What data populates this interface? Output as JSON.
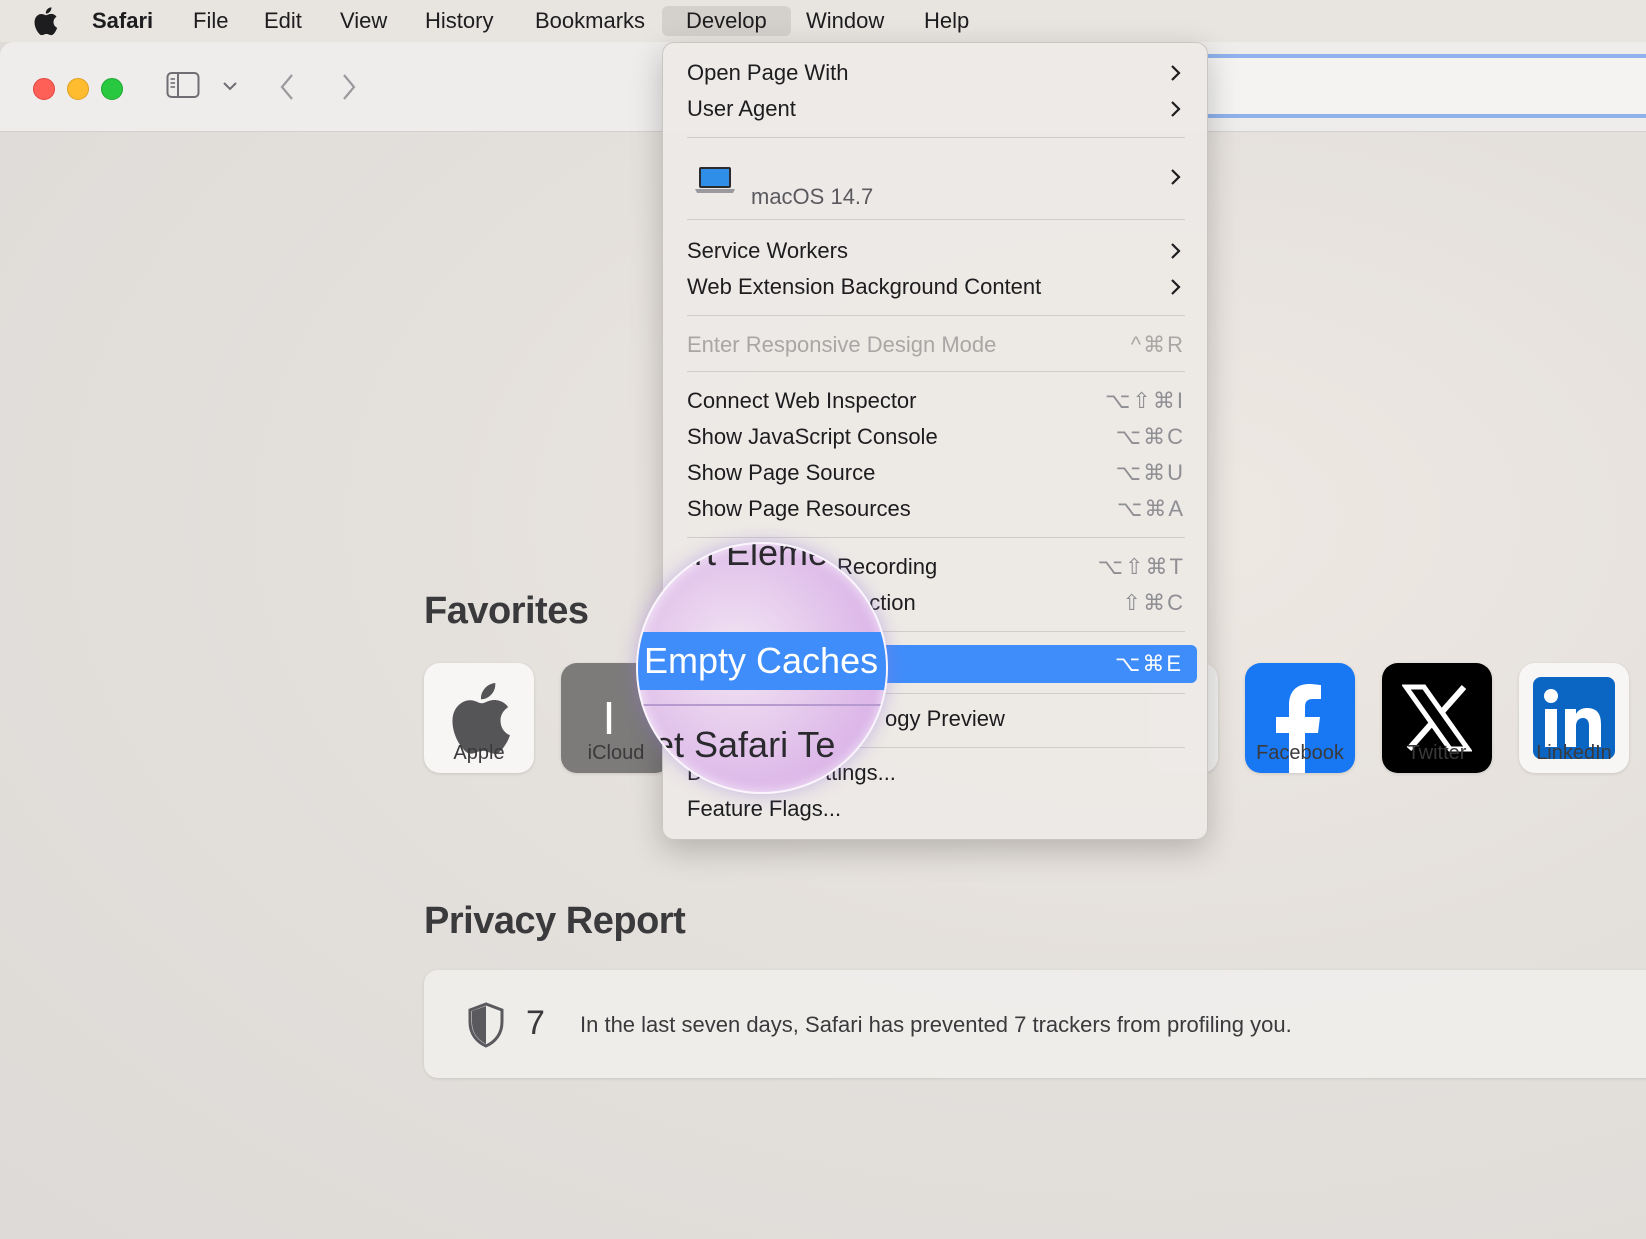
{
  "menubar": {
    "apple_icon": "apple-logo-icon",
    "app": "Safari",
    "items": [
      "File",
      "Edit",
      "View",
      "History",
      "Bookmarks",
      "Develop",
      "Window",
      "Help"
    ],
    "active": "Develop"
  },
  "toolbar": {
    "icons": [
      "sidebar-icon",
      "chevron-down-icon",
      "back-icon",
      "forward-icon"
    ]
  },
  "develop_menu": {
    "open_page_with": "Open Page With",
    "user_agent": "User Agent",
    "device": "macOS 14.7",
    "service_workers": "Service Workers",
    "web_extension": "Web Extension Background Content",
    "responsive": {
      "label": "Enter Responsive Design Mode",
      "shortcut": "^⌘R"
    },
    "connect_inspector": {
      "label": "Connect Web Inspector",
      "shortcut": "⌥⇧⌘I"
    },
    "js_console": {
      "label": "Show JavaScript Console",
      "shortcut": "⌥⌘C"
    },
    "page_source": {
      "label": "Show Page Source",
      "shortcut": "⌥⌘U"
    },
    "page_resources": {
      "label": "Show Page Resources",
      "shortcut": "⌥⌘A"
    },
    "recording": {
      "label": "Recording",
      "shortcut": "⌥⇧⌘T"
    },
    "selection": {
      "label": "ection",
      "shortcut": "⇧⌘C"
    },
    "empty_caches": {
      "shortcut": "⌥⌘E"
    },
    "tech_preview": "ogy Preview",
    "settings": "ttings...",
    "settings_prefix": "D",
    "feature_flags": "Feature Flags..."
  },
  "magnifier": {
    "top_text": "art Eleme",
    "highlight_text": "Empty Caches",
    "bottom_text": "et Safari Te"
  },
  "favorites": {
    "title": "Favorites",
    "items": [
      {
        "label": "Apple",
        "icon": "apple-logo-icon"
      },
      {
        "label": "iCloud",
        "icon": "icloud-icon"
      },
      {
        "label": "Facebook",
        "icon": "facebook-icon"
      },
      {
        "label": "Twitter",
        "icon": "x-icon"
      },
      {
        "label": "LinkedIn",
        "icon": "linkedin-icon"
      }
    ],
    "icloud_glyph": "I"
  },
  "privacy": {
    "title": "Privacy Report",
    "count": "7",
    "message": "In the last seven days, Safari has prevented 7 trackers from profiling you."
  }
}
